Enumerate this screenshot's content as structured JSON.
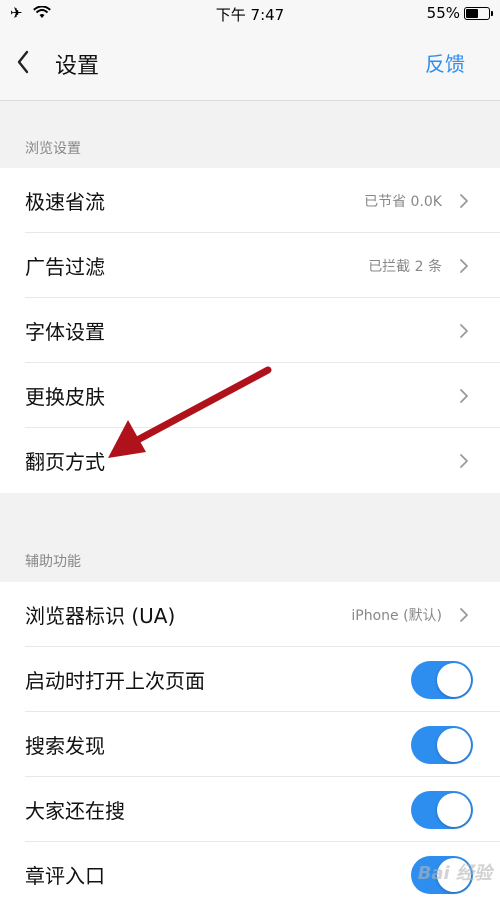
{
  "status_bar": {
    "time": "下午 7:47",
    "battery": "55%",
    "battery_level": 0.55
  },
  "nav": {
    "title": "设置",
    "feedback": "反馈"
  },
  "browse_section": {
    "label": "浏览设置",
    "items": [
      {
        "label": "极速省流",
        "value": "已节省 0.0K"
      },
      {
        "label": "广告过滤",
        "value": "已拦截 2 条"
      },
      {
        "label": "字体设置",
        "value": ""
      },
      {
        "label": "更换皮肤",
        "value": ""
      },
      {
        "label": "翻页方式",
        "value": ""
      }
    ]
  },
  "assist_section": {
    "label": "辅助功能",
    "ua": {
      "label": "浏览器标识 (UA)",
      "value": "iPhone (默认)"
    },
    "toggles": [
      {
        "label": "启动时打开上次页面",
        "on": true
      },
      {
        "label": "搜索发现",
        "on": true
      },
      {
        "label": "大家还在搜",
        "on": true
      },
      {
        "label": "章评入口",
        "on": true
      }
    ]
  },
  "colors": {
    "accent": "#2d8ef0",
    "annotation_arrow": "#b0121b"
  },
  "watermark": "Bai 经验"
}
